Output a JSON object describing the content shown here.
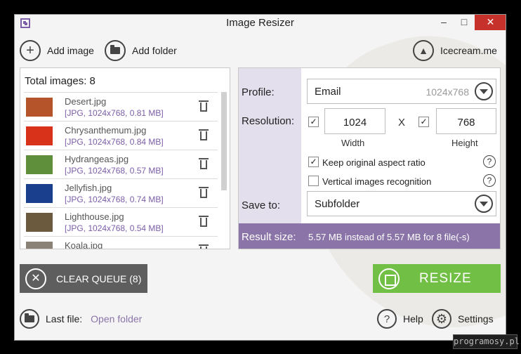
{
  "window": {
    "title": "Image Resizer",
    "min": "–",
    "max": "□",
    "close": "✕"
  },
  "toolbar": {
    "add_image_icon": "plus-icon",
    "add_image": "Add image",
    "add_folder_icon": "folder-icon",
    "add_folder": "Add folder",
    "brand_icon": "icecream-logo-icon",
    "brand": "Icecream.me"
  },
  "list": {
    "total": "Total images: 8",
    "items": [
      {
        "name": "Desert.jpg",
        "meta": "[JPG, 1024x768, 0.81 MB]",
        "thumb_color": "#b5532a"
      },
      {
        "name": "Chrysanthemum.jpg",
        "meta": "[JPG, 1024x768, 0.84 MB]",
        "thumb_color": "#d8321a"
      },
      {
        "name": "Hydrangeas.jpg",
        "meta": "[JPG, 1024x768, 0.57 MB]",
        "thumb_color": "#5f8f3a"
      },
      {
        "name": "Jellyfish.jpg",
        "meta": "[JPG, 1024x768, 0.74 MB]",
        "thumb_color": "#1a3f8c"
      },
      {
        "name": "Lighthouse.jpg",
        "meta": "[JPG, 1024x768, 0.54 MB]",
        "thumb_color": "#6b5a3e"
      },
      {
        "name": "Koala.jpg",
        "meta": "",
        "thumb_color": "#8a8276"
      }
    ]
  },
  "settings": {
    "profile_label": "Profile:",
    "profile_value": "Email",
    "profile_hint": "1024x768",
    "resolution_label": "Resolution:",
    "width": "1024",
    "height": "768",
    "times": "X",
    "width_label": "Width",
    "height_label": "Height",
    "keep_aspect": "Keep original aspect ratio",
    "vertical": "Vertical images recognition",
    "saveto_label": "Save to:",
    "saveto_value": "Subfolder",
    "result_label": "Result size:",
    "result_value": "5.57 MB instead of 5.57 MB for 8 file(-s)",
    "help_glyph": "?",
    "check_glyph": "✓"
  },
  "actions": {
    "clear": "CLEAR QUEUE (8)",
    "resize": "RESIZE"
  },
  "footer": {
    "last_file": "Last file:",
    "open_folder": "Open folder",
    "help": "Help",
    "settings": "Settings"
  },
  "watermark_site": "programosy.pl",
  "colors": {
    "accent": "#8b74a8",
    "resize": "#71bf44",
    "clear": "#5e5e5e",
    "close": "#c7312c"
  }
}
